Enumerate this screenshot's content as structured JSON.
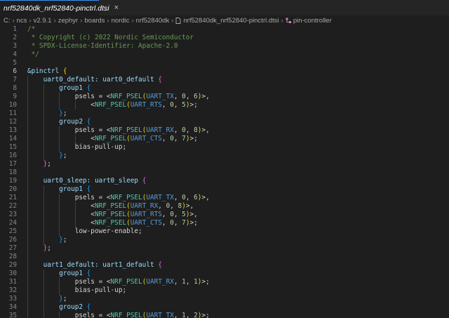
{
  "tab": {
    "filename": "nrf52840dk_nrf52840-pinctrl.dtsi",
    "close_glyph": "×"
  },
  "breadcrumb": [
    "C:",
    "ncs",
    "v2.9.1",
    "zephyr",
    "boards",
    "nordic",
    "nrf52840dk",
    "nrf52840dk_nrf52840-pinctrl.dtsi",
    "pin-controller"
  ],
  "editor": {
    "active_line": 6,
    "lines": [
      {
        "n": 1,
        "t": [
          [
            "/*",
            "cm"
          ]
        ]
      },
      {
        "n": 2,
        "t": [
          [
            " * Copyright (c) 2022 Nordic Semiconductor",
            "cm"
          ]
        ]
      },
      {
        "n": 3,
        "t": [
          [
            " * SPDX-License-Identifier: Apache-2.0",
            "cm"
          ]
        ]
      },
      {
        "n": 4,
        "t": [
          [
            " */",
            "cm"
          ]
        ]
      },
      {
        "n": 5,
        "t": []
      },
      {
        "n": 6,
        "t": [
          [
            "&pinctrl ",
            "nm"
          ],
          [
            "{",
            "b1"
          ]
        ]
      },
      {
        "n": 7,
        "t": [
          [
            "    ",
            "df"
          ],
          [
            "uart0_default: uart0_default ",
            "nm"
          ],
          [
            "{",
            "b2"
          ]
        ]
      },
      {
        "n": 8,
        "t": [
          [
            "        ",
            "df"
          ],
          [
            "group1 ",
            "nm"
          ],
          [
            "{",
            "b3"
          ]
        ]
      },
      {
        "n": 9,
        "t": [
          [
            "            psels = <",
            "df"
          ],
          [
            "NRF_PSEL",
            "pf"
          ],
          [
            "(",
            "b1"
          ],
          [
            "UART_TX",
            "kw"
          ],
          [
            ", ",
            "df"
          ],
          [
            "0",
            "num"
          ],
          [
            ", ",
            "df"
          ],
          [
            "6",
            "num"
          ],
          [
            ")",
            "b1"
          ],
          [
            ">,",
            "df"
          ]
        ]
      },
      {
        "n": 10,
        "t": [
          [
            "                <",
            "df"
          ],
          [
            "NRF_PSEL",
            "pf"
          ],
          [
            "(",
            "b1"
          ],
          [
            "UART_RTS",
            "kw"
          ],
          [
            ", ",
            "df"
          ],
          [
            "0",
            "num"
          ],
          [
            ", ",
            "df"
          ],
          [
            "5",
            "num"
          ],
          [
            ")",
            "b1"
          ],
          [
            ">;",
            "df"
          ]
        ]
      },
      {
        "n": 11,
        "t": [
          [
            "        ",
            "df"
          ],
          [
            "}",
            "b3"
          ],
          [
            ";",
            "df"
          ]
        ]
      },
      {
        "n": 12,
        "t": [
          [
            "        ",
            "df"
          ],
          [
            "group2 ",
            "nm"
          ],
          [
            "{",
            "b3"
          ]
        ]
      },
      {
        "n": 13,
        "t": [
          [
            "            psels = <",
            "df"
          ],
          [
            "NRF_PSEL",
            "pf"
          ],
          [
            "(",
            "b1"
          ],
          [
            "UART_RX",
            "kw"
          ],
          [
            ", ",
            "df"
          ],
          [
            "0",
            "num"
          ],
          [
            ", ",
            "df"
          ],
          [
            "8",
            "num"
          ],
          [
            ")",
            "b1"
          ],
          [
            ">,",
            "df"
          ]
        ]
      },
      {
        "n": 14,
        "t": [
          [
            "                <",
            "df"
          ],
          [
            "NRF_PSEL",
            "pf"
          ],
          [
            "(",
            "b1"
          ],
          [
            "UART_CTS",
            "kw"
          ],
          [
            ", ",
            "df"
          ],
          [
            "0",
            "num"
          ],
          [
            ", ",
            "df"
          ],
          [
            "7",
            "num"
          ],
          [
            ")",
            "b1"
          ],
          [
            ">;",
            "df"
          ]
        ]
      },
      {
        "n": 15,
        "t": [
          [
            "            bias-pull-up;",
            "df"
          ]
        ]
      },
      {
        "n": 16,
        "t": [
          [
            "        ",
            "df"
          ],
          [
            "}",
            "b3"
          ],
          [
            ";",
            "df"
          ]
        ]
      },
      {
        "n": 17,
        "t": [
          [
            "    ",
            "df"
          ],
          [
            "}",
            "b2"
          ],
          [
            ";",
            "df"
          ]
        ]
      },
      {
        "n": 18,
        "t": []
      },
      {
        "n": 19,
        "t": [
          [
            "    ",
            "df"
          ],
          [
            "uart0_sleep: uart0_sleep ",
            "nm"
          ],
          [
            "{",
            "b2"
          ]
        ]
      },
      {
        "n": 20,
        "t": [
          [
            "        ",
            "df"
          ],
          [
            "group1 ",
            "nm"
          ],
          [
            "{",
            "b3"
          ]
        ]
      },
      {
        "n": 21,
        "t": [
          [
            "            psels = <",
            "df"
          ],
          [
            "NRF_PSEL",
            "pf"
          ],
          [
            "(",
            "b1"
          ],
          [
            "UART_TX",
            "kw"
          ],
          [
            ", ",
            "df"
          ],
          [
            "0",
            "num"
          ],
          [
            ", ",
            "df"
          ],
          [
            "6",
            "num"
          ],
          [
            ")",
            "b1"
          ],
          [
            ">,",
            "df"
          ]
        ]
      },
      {
        "n": 22,
        "t": [
          [
            "                <",
            "df"
          ],
          [
            "NRF_PSEL",
            "pf"
          ],
          [
            "(",
            "b1"
          ],
          [
            "UART_RX",
            "kw"
          ],
          [
            ", ",
            "df"
          ],
          [
            "0",
            "num"
          ],
          [
            ", ",
            "df"
          ],
          [
            "8",
            "num"
          ],
          [
            ")",
            "b1"
          ],
          [
            ">,",
            "df"
          ]
        ]
      },
      {
        "n": 23,
        "t": [
          [
            "                <",
            "df"
          ],
          [
            "NRF_PSEL",
            "pf"
          ],
          [
            "(",
            "b1"
          ],
          [
            "UART_RTS",
            "kw"
          ],
          [
            ", ",
            "df"
          ],
          [
            "0",
            "num"
          ],
          [
            ", ",
            "df"
          ],
          [
            "5",
            "num"
          ],
          [
            ")",
            "b1"
          ],
          [
            ">,",
            "df"
          ]
        ]
      },
      {
        "n": 24,
        "t": [
          [
            "                <",
            "df"
          ],
          [
            "NRF_PSEL",
            "pf"
          ],
          [
            "(",
            "b1"
          ],
          [
            "UART_CTS",
            "kw"
          ],
          [
            ", ",
            "df"
          ],
          [
            "0",
            "num"
          ],
          [
            ", ",
            "df"
          ],
          [
            "7",
            "num"
          ],
          [
            ")",
            "b1"
          ],
          [
            ">;",
            "df"
          ]
        ]
      },
      {
        "n": 25,
        "t": [
          [
            "            low-power-enable;",
            "df"
          ]
        ]
      },
      {
        "n": 26,
        "t": [
          [
            "        ",
            "df"
          ],
          [
            "}",
            "b3"
          ],
          [
            ";",
            "df"
          ]
        ]
      },
      {
        "n": 27,
        "t": [
          [
            "    ",
            "df"
          ],
          [
            "}",
            "b2"
          ],
          [
            ";",
            "df"
          ]
        ]
      },
      {
        "n": 28,
        "t": []
      },
      {
        "n": 29,
        "t": [
          [
            "    ",
            "df"
          ],
          [
            "uart1_default: uart1_default ",
            "nm"
          ],
          [
            "{",
            "b2"
          ]
        ]
      },
      {
        "n": 30,
        "t": [
          [
            "        ",
            "df"
          ],
          [
            "group1 ",
            "nm"
          ],
          [
            "{",
            "b3"
          ]
        ]
      },
      {
        "n": 31,
        "t": [
          [
            "            psels = <",
            "df"
          ],
          [
            "NRF_PSEL",
            "pf"
          ],
          [
            "(",
            "b1"
          ],
          [
            "UART_RX",
            "kw"
          ],
          [
            ", ",
            "df"
          ],
          [
            "1",
            "num"
          ],
          [
            ", ",
            "df"
          ],
          [
            "1",
            "num"
          ],
          [
            ")",
            "b1"
          ],
          [
            ">;",
            "df"
          ]
        ]
      },
      {
        "n": 32,
        "t": [
          [
            "            bias-pull-up;",
            "df"
          ]
        ]
      },
      {
        "n": 33,
        "t": [
          [
            "        ",
            "df"
          ],
          [
            "}",
            "b3"
          ],
          [
            ";",
            "df"
          ]
        ]
      },
      {
        "n": 34,
        "t": [
          [
            "        ",
            "df"
          ],
          [
            "group2 ",
            "nm"
          ],
          [
            "{",
            "b3"
          ]
        ]
      },
      {
        "n": 35,
        "t": [
          [
            "            psels = <",
            "df"
          ],
          [
            "NRF_PSEL",
            "pf"
          ],
          [
            "(",
            "b1"
          ],
          [
            "UART_TX",
            "kw"
          ],
          [
            ", ",
            "df"
          ],
          [
            "1",
            "num"
          ],
          [
            ", ",
            "df"
          ],
          [
            "2",
            "num"
          ],
          [
            ")",
            "b1"
          ],
          [
            ">;",
            "df"
          ]
        ]
      }
    ]
  }
}
